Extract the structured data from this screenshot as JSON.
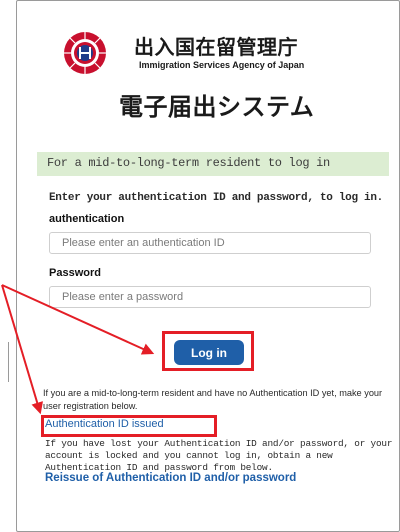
{
  "header": {
    "agency_ja": "出入国在留管理庁",
    "agency_en": "Immigration Services Agency of Japan",
    "system_title": "電子届出システム",
    "emblem_icon": "immigration-agency-emblem"
  },
  "login": {
    "section_title": "For a mid-to-long-term resident to log in",
    "instruction": "Enter your authentication ID and password, to log in.",
    "auth_label": "authentication",
    "auth_placeholder": "Please enter an authentication ID",
    "password_label": "Password",
    "password_placeholder": "Please enter a password",
    "login_button": "Log in"
  },
  "help": {
    "no_id_text": "If you are a mid-to-long-term resident and have no Authentication ID yet, make your user registration below.",
    "issue_link": "Authentication ID issued",
    "lost_text": "If you have lost your Authentication ID and/or password, or your account is locked and you cannot log in, obtain a new Authentication ID and password from below.",
    "reissue_link": "Reissue of Authentication ID and/or password"
  },
  "colors": {
    "accent": "#1f5fa8",
    "section_bg": "#dcedd2",
    "highlight": "#e41e26"
  }
}
